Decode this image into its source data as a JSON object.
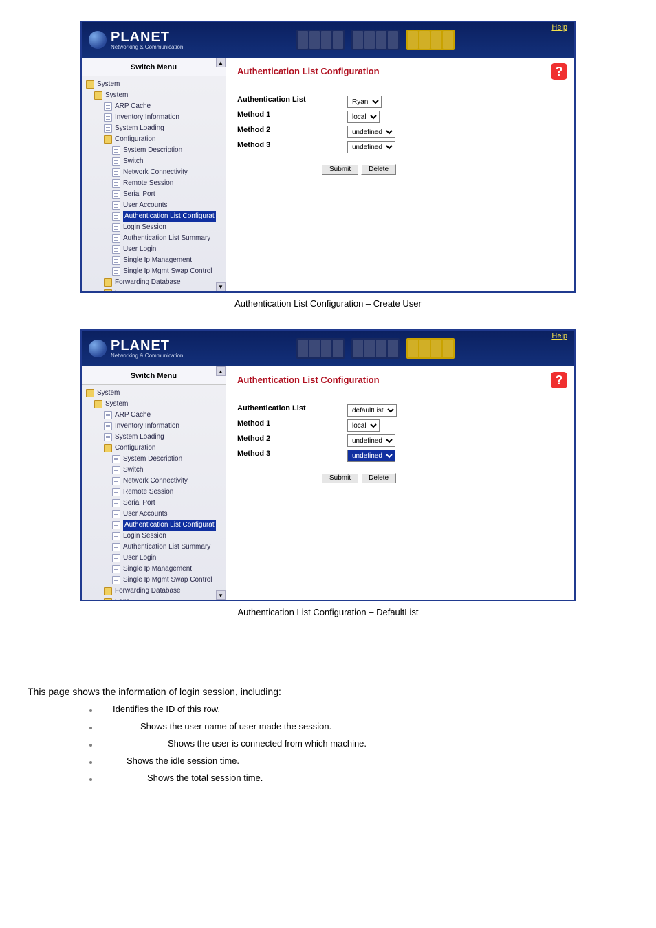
{
  "brand": {
    "name": "PLANET",
    "tagline": "Networking & Communication"
  },
  "topbar": {
    "help": "Help"
  },
  "sidebar": {
    "header": "Switch Menu",
    "root": "System",
    "system": "System",
    "items": [
      "ARP Cache",
      "Inventory Information",
      "System Loading"
    ],
    "config_folder": "Configuration",
    "config_items": [
      "System Description",
      "Switch",
      "Network Connectivity",
      "Remote Session",
      "Serial Port",
      "User Accounts",
      "Authentication List Configurat",
      "Login Session",
      "Authentication List Summary",
      "User Login",
      "Single Ip Management",
      "Single Ip Mgmt Swap Control"
    ],
    "fwd_db": "Forwarding Database",
    "logs": "Logs"
  },
  "panel": {
    "title": "Authentication List Configuration",
    "labels": {
      "auth_list": "Authentication List",
      "m1": "Method 1",
      "m2": "Method 2",
      "m3": "Method 3"
    },
    "buttons": {
      "submit": "Submit",
      "delete": "Delete"
    }
  },
  "screenshot1": {
    "values": {
      "auth_list": "Ryan",
      "m1": "local",
      "m2": "undefined",
      "m3": "undefined"
    }
  },
  "screenshot2": {
    "values": {
      "auth_list": "defaultList",
      "m1": "local",
      "m2": "undefined",
      "m3": "undefined"
    }
  },
  "captions": {
    "c1": "Authentication List Configuration – Create User",
    "c2": "Authentication List Configuration – DefaultList"
  },
  "body": {
    "intro": "This page shows the information of login session, including:",
    "bullets": [
      "Identifies the ID of this row.",
      "Shows the user name of user made the session.",
      "Shows the user is connected from which machine.",
      "Shows the idle session time.",
      "Shows the total session time."
    ]
  }
}
